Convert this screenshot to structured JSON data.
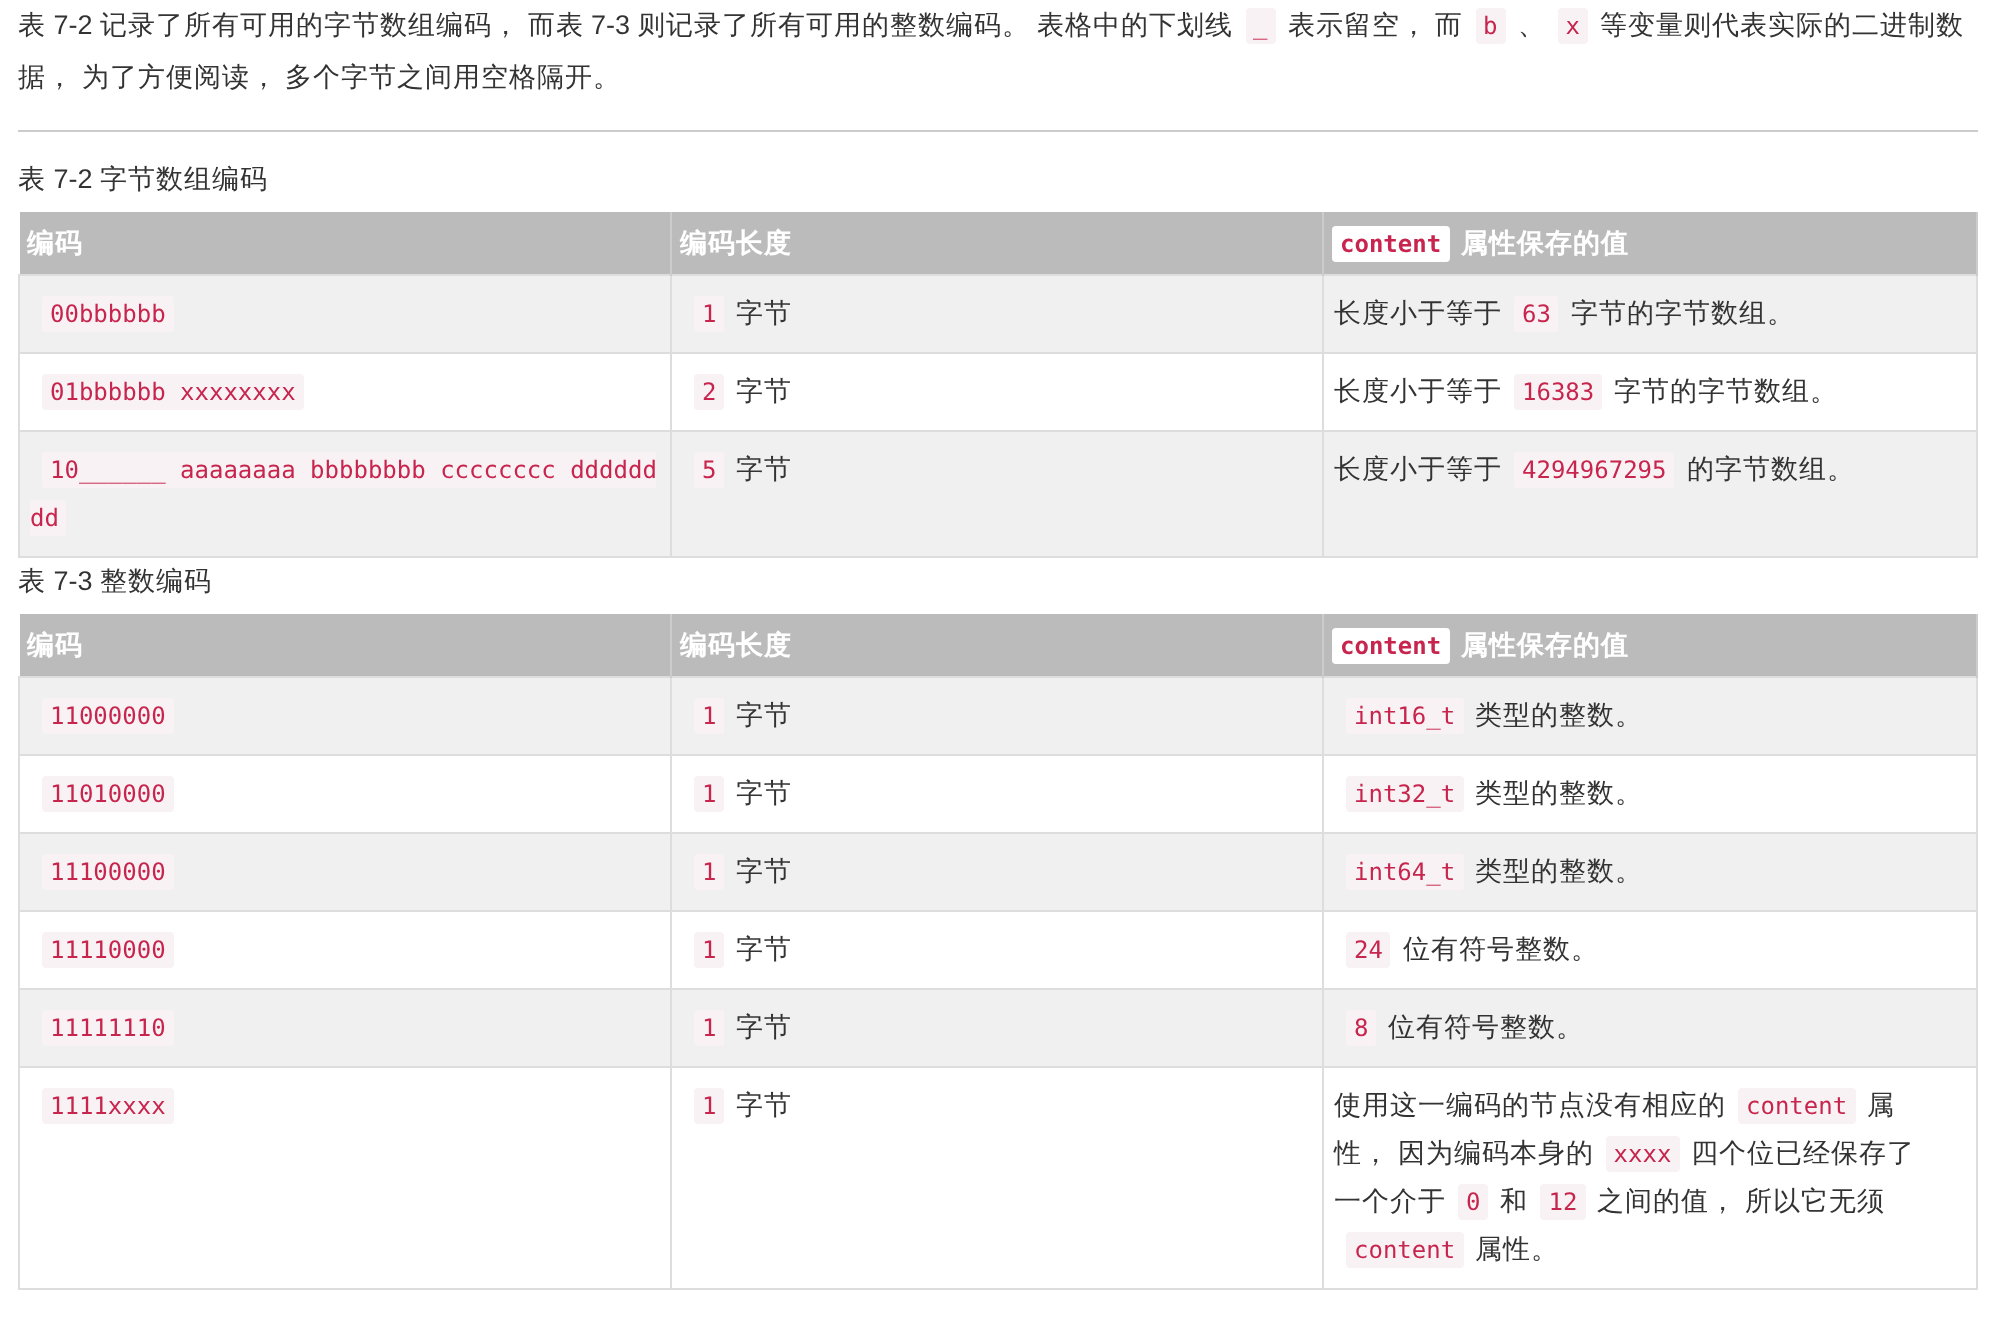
{
  "intro": [
    {
      "kind": "text",
      "text": "表 7-2 记录了所有可用的字节数组编码， 而表 7-3 则记录了所有可用的整数编码。 表格中的下划线"
    },
    {
      "kind": "code",
      "text": "_"
    },
    {
      "kind": "text",
      "text": "表示留空， 而"
    },
    {
      "kind": "code",
      "text": "b"
    },
    {
      "kind": "text",
      "text": "、"
    },
    {
      "kind": "code",
      "text": "x"
    },
    {
      "kind": "text",
      "text": "等变量则代表实际的二进制数据， 为了方便阅读， 多个字节之间用空格隔开。"
    }
  ],
  "tables": [
    {
      "caption": "表 7-2 字节数组编码",
      "columns": [
        {
          "label": "编码"
        },
        {
          "label": "编码长度"
        },
        {
          "code": "content",
          "label": "属性保存的值"
        }
      ],
      "rows": [
        {
          "cells": [
            {
              "parts": [
                {
                  "kind": "code",
                  "text": "00bbbbbb"
                }
              ]
            },
            {
              "parts": [
                {
                  "kind": "code",
                  "text": "1"
                },
                {
                  "kind": "text",
                  "text": "字节"
                }
              ]
            },
            {
              "parts": [
                {
                  "kind": "text",
                  "text": "长度小于等于"
                },
                {
                  "kind": "code",
                  "text": "63"
                },
                {
                  "kind": "text",
                  "text": "字节的字节数组。"
                }
              ]
            }
          ]
        },
        {
          "cells": [
            {
              "parts": [
                {
                  "kind": "code",
                  "text": "01bbbbbb xxxxxxxx"
                }
              ]
            },
            {
              "parts": [
                {
                  "kind": "code",
                  "text": "2"
                },
                {
                  "kind": "text",
                  "text": "字节"
                }
              ]
            },
            {
              "parts": [
                {
                  "kind": "text",
                  "text": "长度小于等于"
                },
                {
                  "kind": "code",
                  "text": "16383"
                },
                {
                  "kind": "text",
                  "text": "字节的字节数组。"
                }
              ]
            }
          ]
        },
        {
          "cells": [
            {
              "parts": [
                {
                  "kind": "code",
                  "text": "10______ aaaaaaaa bbbbbbbb cccccccc dddddddd"
                }
              ]
            },
            {
              "parts": [
                {
                  "kind": "code",
                  "text": "5"
                },
                {
                  "kind": "text",
                  "text": "字节"
                }
              ]
            },
            {
              "parts": [
                {
                  "kind": "text",
                  "text": "长度小于等于"
                },
                {
                  "kind": "code",
                  "text": "4294967295"
                },
                {
                  "kind": "text",
                  "text": "的字节数组。"
                }
              ]
            }
          ]
        }
      ]
    },
    {
      "caption": "表 7-3 整数编码",
      "columns": [
        {
          "label": "编码"
        },
        {
          "label": "编码长度"
        },
        {
          "code": "content",
          "label": "属性保存的值"
        }
      ],
      "rows": [
        {
          "cells": [
            {
              "parts": [
                {
                  "kind": "code",
                  "text": "11000000"
                }
              ]
            },
            {
              "parts": [
                {
                  "kind": "code",
                  "text": "1"
                },
                {
                  "kind": "text",
                  "text": "字节"
                }
              ]
            },
            {
              "parts": [
                {
                  "kind": "code",
                  "text": "int16_t"
                },
                {
                  "kind": "text",
                  "text": "类型的整数。"
                }
              ]
            }
          ]
        },
        {
          "cells": [
            {
              "parts": [
                {
                  "kind": "code",
                  "text": "11010000"
                }
              ]
            },
            {
              "parts": [
                {
                  "kind": "code",
                  "text": "1"
                },
                {
                  "kind": "text",
                  "text": "字节"
                }
              ]
            },
            {
              "parts": [
                {
                  "kind": "code",
                  "text": "int32_t"
                },
                {
                  "kind": "text",
                  "text": "类型的整数。"
                }
              ]
            }
          ]
        },
        {
          "cells": [
            {
              "parts": [
                {
                  "kind": "code",
                  "text": "11100000"
                }
              ]
            },
            {
              "parts": [
                {
                  "kind": "code",
                  "text": "1"
                },
                {
                  "kind": "text",
                  "text": "字节"
                }
              ]
            },
            {
              "parts": [
                {
                  "kind": "code",
                  "text": "int64_t"
                },
                {
                  "kind": "text",
                  "text": "类型的整数。"
                }
              ]
            }
          ]
        },
        {
          "cells": [
            {
              "parts": [
                {
                  "kind": "code",
                  "text": "11110000"
                }
              ]
            },
            {
              "parts": [
                {
                  "kind": "code",
                  "text": "1"
                },
                {
                  "kind": "text",
                  "text": "字节"
                }
              ]
            },
            {
              "parts": [
                {
                  "kind": "code",
                  "text": "24"
                },
                {
                  "kind": "text",
                  "text": "位有符号整数。"
                }
              ]
            }
          ]
        },
        {
          "cells": [
            {
              "parts": [
                {
                  "kind": "code",
                  "text": "11111110"
                }
              ]
            },
            {
              "parts": [
                {
                  "kind": "code",
                  "text": "1"
                },
                {
                  "kind": "text",
                  "text": "字节"
                }
              ]
            },
            {
              "parts": [
                {
                  "kind": "code",
                  "text": "8"
                },
                {
                  "kind": "text",
                  "text": "位有符号整数。"
                }
              ]
            }
          ]
        },
        {
          "cells": [
            {
              "parts": [
                {
                  "kind": "code",
                  "text": "1111xxxx"
                }
              ]
            },
            {
              "parts": [
                {
                  "kind": "code",
                  "text": "1"
                },
                {
                  "kind": "text",
                  "text": "字节"
                }
              ]
            },
            {
              "parts": [
                {
                  "kind": "text",
                  "text": "使用这一编码的节点没有相应的"
                },
                {
                  "kind": "code",
                  "text": "content"
                },
                {
                  "kind": "text",
                  "text": "属性， 因为编码本身的"
                },
                {
                  "kind": "code",
                  "text": "xxxx"
                },
                {
                  "kind": "text",
                  "text": "四个位已经保存了一个介于"
                },
                {
                  "kind": "code",
                  "text": "0"
                },
                {
                  "kind": "text",
                  "text": "和"
                },
                {
                  "kind": "code",
                  "text": "12"
                },
                {
                  "kind": "text",
                  "text": "之间的值， 所以它无须"
                },
                {
                  "kind": "code",
                  "text": "content"
                },
                {
                  "kind": "text",
                  "text": "属性。"
                }
              ]
            }
          ]
        }
      ]
    }
  ]
}
